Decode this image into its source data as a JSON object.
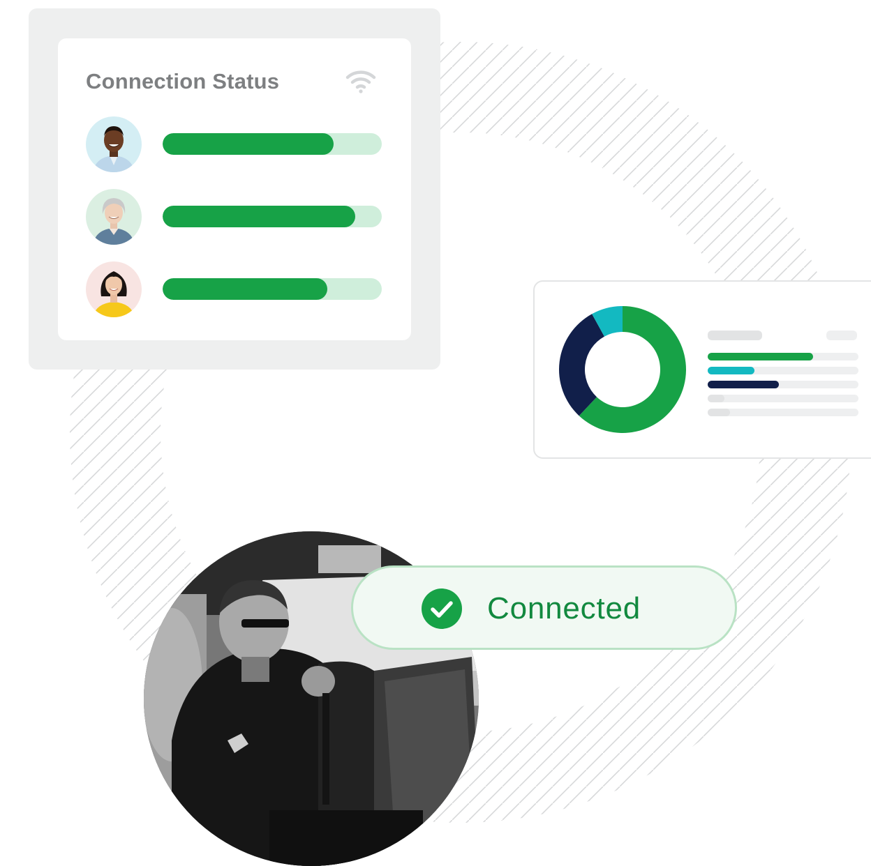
{
  "connection_status": {
    "title": "Connection Status",
    "icon": "wifi-icon",
    "users": [
      {
        "avatar": "avatar-man-smiling",
        "signal_level": 0.78
      },
      {
        "avatar": "avatar-gray-haired-woman",
        "signal_level": 0.88
      },
      {
        "avatar": "avatar-woman-yellow-shirt",
        "signal_level": 0.75
      }
    ]
  },
  "donut_widget": {
    "segments": [
      {
        "share": 0.62,
        "color": "#17a247"
      },
      {
        "share": 0.3,
        "color": "#111f4a"
      },
      {
        "share": 0.08,
        "color": "#13b9c1"
      }
    ],
    "legend_bars": [
      {
        "level": 0.7,
        "color": "#17a247"
      },
      {
        "level": 0.31,
        "color": "#13b9c1"
      },
      {
        "level": 0.47,
        "color": "#111f4a"
      },
      {
        "level": 0.11,
        "color": "#e2e3e4"
      },
      {
        "level": 0.15,
        "color": "#e2e3e4"
      }
    ]
  },
  "status_badge": {
    "label": "Connected",
    "icon": "check-circle-icon"
  },
  "photo": {
    "subject": "officer-in-patrol-car"
  },
  "colors": {
    "brand_green": "#17a247",
    "light_green": "#cfeedb",
    "navy": "#111f4a",
    "teal": "#13b9c1",
    "title_gray": "#7d7f81"
  }
}
